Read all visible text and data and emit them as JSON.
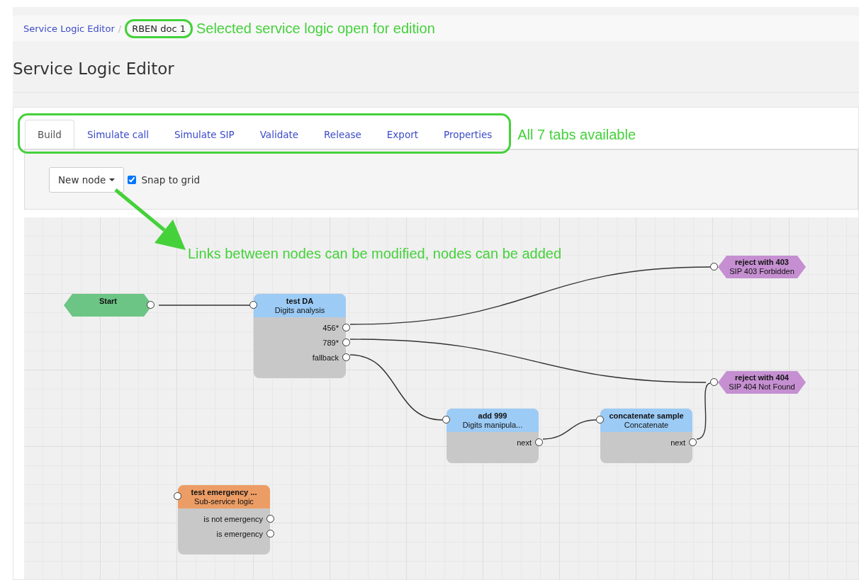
{
  "breadcrumb": {
    "separator": "/",
    "items": [
      {
        "label": "Service Logic Editor",
        "selected": false
      },
      {
        "label": "RBEN doc 1",
        "selected": true
      }
    ]
  },
  "annotations": {
    "breadcrumb_note": "Selected service logic open for edition",
    "tabs_note": "All 7 tabs available",
    "canvas_note": "Links between nodes can be modified, nodes can be added"
  },
  "page_title": "Service Logic Editor",
  "tabs": [
    {
      "label": "Build",
      "selected": true
    },
    {
      "label": "Simulate call",
      "selected": false
    },
    {
      "label": "Simulate SIP",
      "selected": false
    },
    {
      "label": "Validate",
      "selected": false
    },
    {
      "label": "Release",
      "selected": false
    },
    {
      "label": "Export",
      "selected": false
    },
    {
      "label": "Properties",
      "selected": false
    }
  ],
  "toolbar": {
    "new_node_button": "New node",
    "snap_to_grid": {
      "label": "Snap to grid",
      "checked": true
    }
  },
  "nodes": [
    {
      "kind": "start",
      "title": "Start"
    },
    {
      "kind": "action",
      "title": "test DA",
      "subtitle": "Digits analysis",
      "outputs": [
        "456*",
        "789*",
        "fallback"
      ]
    },
    {
      "kind": "end",
      "title": "reject with 403",
      "subtitle": "SIP 403 Forbidden"
    },
    {
      "kind": "end",
      "title": "reject with 404",
      "subtitle": "SIP 404 Not Found"
    },
    {
      "kind": "action",
      "title": "add 999",
      "subtitle": "Digits manipula...",
      "outputs": [
        "next"
      ]
    },
    {
      "kind": "action",
      "title": "concatenate sample",
      "subtitle": "Concatenate",
      "outputs": [
        "next"
      ]
    },
    {
      "kind": "subservice",
      "title": "test emergency ...",
      "subtitle": "Sub-service logic",
      "outputs": [
        "is not emergency",
        "is emergency"
      ]
    }
  ]
}
